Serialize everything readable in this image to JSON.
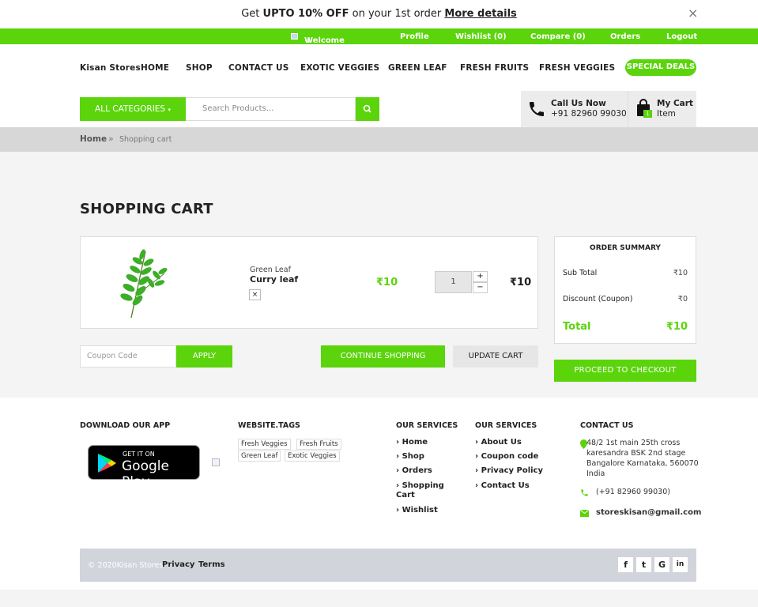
{
  "promo": {
    "text_before": "Get ",
    "highlight": "UPTO 10% OFF",
    "text_after": " on your 1st order ",
    "link": "More details",
    "close_glyph": "×"
  },
  "userbar": {
    "welcome": "Welcome Chirag",
    "welcome_suffix": "!",
    "profile": "Profile",
    "wishlist": "Wishlist (0)",
    "compare": "Compare (0)",
    "orders": "Orders",
    "logout": "Logout"
  },
  "nav": {
    "brand": "Kisan Stores",
    "items": [
      "HOME",
      "SHOP",
      "CONTACT US",
      "EXOTIC VEGGIES",
      "GREEN LEAF",
      "FRESH FRUITS",
      "FRESH VEGGIES"
    ],
    "special": "SPECIAL DEALS"
  },
  "search": {
    "category_label": "ALL CATEGORIES",
    "placeholder": "Search Products..."
  },
  "call": {
    "label": "Call Us Now",
    "phone": "+91 82960 99030"
  },
  "cart": {
    "label": "My Cart",
    "items_label": "Item",
    "count": "1"
  },
  "breadcrumb": {
    "home": "Home",
    "separator": "»",
    "current": "Shopping cart"
  },
  "page": {
    "title": "SHOPPING CART"
  },
  "cart_items": [
    {
      "category": "Green Leaf",
      "name": "Curry leaf",
      "remove": "×",
      "unit_price": "₹10",
      "quantity": "1",
      "total": "₹10"
    }
  ],
  "actions": {
    "coupon_placeholder": "Coupon Code",
    "apply": "APPLY",
    "continue": "CONTINUE SHOPPING",
    "update": "UPDATE CART",
    "checkout": "PROCEED TO CHECKOUT"
  },
  "summary": {
    "title": "ORDER SUMMARY",
    "subtotal_label": "Sub Total",
    "subtotal": "₹10",
    "discount_label": "Discount (Coupon)",
    "discount": "₹0",
    "total_label": "Total",
    "total": "₹10"
  },
  "footer": {
    "app_heading": "DOWNLOAD OUR APP",
    "gplay_top": "GET IT ON",
    "gplay_bottom": "Google Play",
    "tags_heading": "WEBSITE.TAGS",
    "tags": [
      "Fresh Veggies",
      "Fresh Fruits",
      "Green Leaf",
      "Exotic Veggies"
    ],
    "services1_heading": "OUR SERVICES",
    "services1": [
      "Home",
      "Shop",
      "Orders",
      "Shopping Cart",
      "Wishlist"
    ],
    "services2_heading": "OUR SERVICES",
    "services2": [
      "About Us",
      "Coupon code",
      "Privacy Policy",
      "Contact Us"
    ],
    "contact_heading": "CONTACT US",
    "address": [
      "48/2 1st main 25th cross",
      "karesandra BSK 2nd stage",
      "Bangalore Karnataka, 560070",
      "India"
    ],
    "phone": "(+91 82960 99030)",
    "email": "storeskisan@gmail.com",
    "copyright": "© 2020Kisan Stores",
    "privacy": "Privacy",
    "terms": "Terms",
    "social": [
      "f",
      "t",
      "G",
      "in"
    ]
  },
  "colors": {
    "accent": "#5bd40c",
    "breadcrumb_bar": "#d7d7d7",
    "copy_bar": "#d1d4da"
  }
}
